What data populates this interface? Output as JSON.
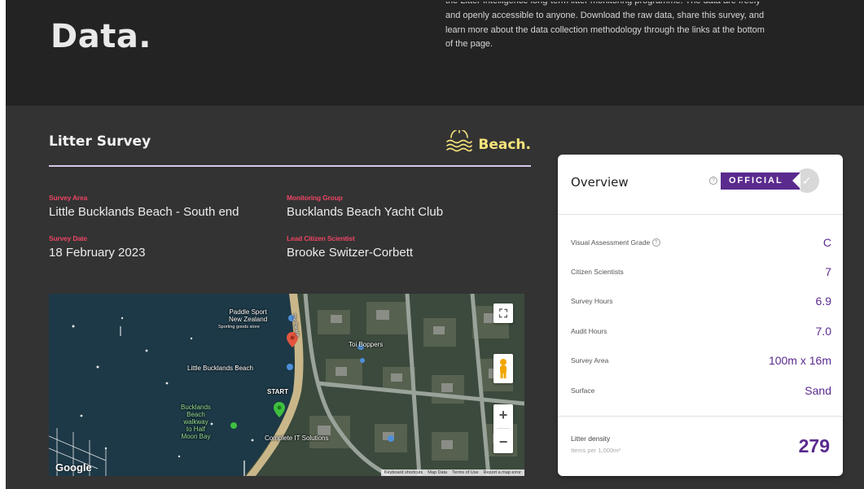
{
  "hero": {
    "title": "Data.",
    "intro_line_cut": "the Litter Intelligence long-term litter monitoring programme. The data are freely",
    "intro_lines": [
      "and openly accessible to anyone. Download the raw data, share this survey, and",
      "learn more about the data collection methodology through the links at the bottom",
      "of the page."
    ]
  },
  "survey": {
    "title": "Litter Survey",
    "type_label": "Beach.",
    "type_icon": "waves-icon",
    "fields": [
      {
        "key": "Survey Area",
        "value": "Little Bucklands Beach - South end"
      },
      {
        "key": "Monitoring Group",
        "value": "Bucklands Beach Yacht Club"
      },
      {
        "key": "Survey Date",
        "value": "18 February 2023"
      },
      {
        "key": "Lead Citizen Scientist",
        "value": "Brooke Switzer-Corbett"
      }
    ]
  },
  "map": {
    "labels": {
      "paddle": "Paddle Sport\nNew Zealand",
      "paddle_sub": "Sporting goods store",
      "little_beach": "Little Bucklands Beach",
      "start": "START",
      "walkway": "Bucklands\nBeach\nwalkway\nto Half\nMoon Bay",
      "toi": "Toi Boppers",
      "complete_it": "Complete IT Solutions",
      "road": "The Parade"
    },
    "google": "Google",
    "footer": [
      "Keyboard shortcuts",
      "Map Data",
      "Terms of Use",
      "Report a map error"
    ],
    "zoom_in": "+",
    "zoom_out": "−",
    "fullscreen": "⛶"
  },
  "overview": {
    "title": "Overview",
    "help_glyph": "?",
    "badge": "OFFICIAL",
    "seal_glyph": "✓",
    "rows": [
      {
        "label": "Visual Assessment Grade",
        "value": "C",
        "help": "?"
      },
      {
        "label": "Citizen Scientists",
        "value": "7"
      },
      {
        "label": "Survey Hours",
        "value": "6.9"
      },
      {
        "label": "Audit Hours",
        "value": "7.0"
      },
      {
        "label": "Survey Area",
        "value": "100m x 16m"
      },
      {
        "label": "Surface",
        "value": "Sand"
      }
    ],
    "density_label": "Litter density",
    "density_sub": "Items per 1,000m²",
    "density_value": "279"
  },
  "colors": {
    "accent": "#5a2a8e",
    "field_key": "#e94563",
    "beach": "#f6e37a",
    "dark_bg": "#333333",
    "hero_bg": "#232323"
  }
}
